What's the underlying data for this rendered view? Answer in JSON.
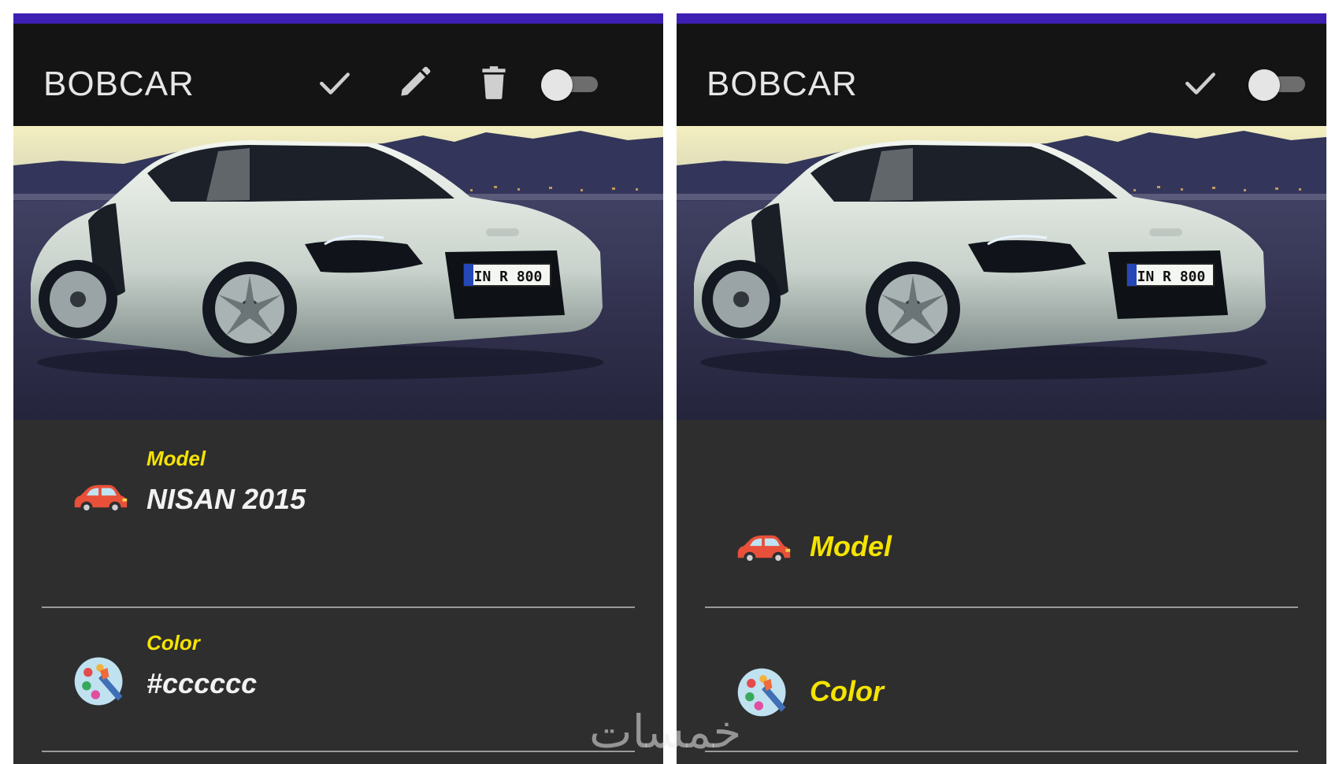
{
  "colors": {
    "status_bar": "#3d1fb3",
    "app_bar": "#141414",
    "content_bg": "#2e2e2e",
    "label_yellow": "#f5e400",
    "value_white": "#f2f2f2"
  },
  "screens": [
    {
      "app_title": "BOBCAR",
      "actions": [
        "check-icon",
        "edit-pencil-icon",
        "delete-trash-icon",
        "toggle-switch"
      ],
      "toggle_on": false,
      "fields": [
        {
          "icon": "car-icon",
          "label": "Model",
          "value": "NISAN 2015"
        },
        {
          "icon": "palette-icon",
          "label": "Color",
          "value": "#cccccc"
        }
      ]
    },
    {
      "app_title": "BOBCAR",
      "actions": [
        "check-icon",
        "toggle-switch"
      ],
      "toggle_on": false,
      "fields": [
        {
          "icon": "car-icon",
          "label": "Model"
        },
        {
          "icon": "palette-icon",
          "label": "Color"
        }
      ]
    }
  ],
  "hero_image": {
    "plate_text": "IN R 800"
  },
  "watermark": "خمسات"
}
